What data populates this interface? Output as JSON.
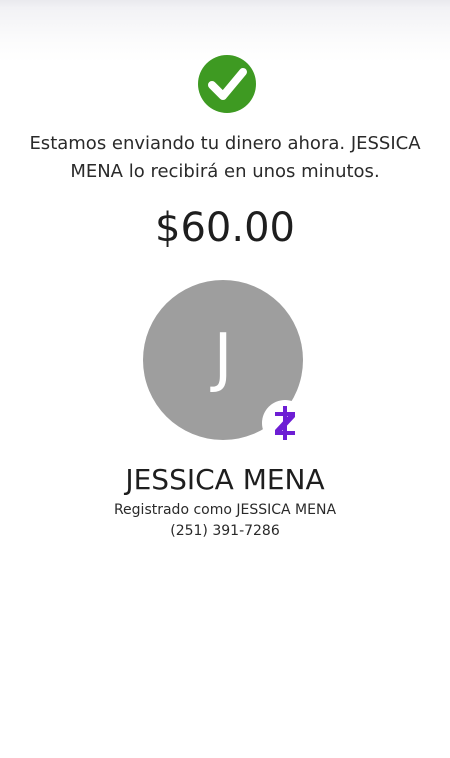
{
  "status": {
    "icon": "check-circle-icon",
    "color": "#3e9a22",
    "message": "Estamos enviando tu dinero ahora. JESSICA MENA lo recibirá en unos minutos."
  },
  "amount": "$60.00",
  "recipient": {
    "initial": "J",
    "avatar_color": "#9e9e9e",
    "name": "JESSICA MENA",
    "registered_as": "Registrado como JESSICA MENA",
    "phone": "(251) 391-7286",
    "badge_icon": "zelle-logo-icon",
    "badge_color": "#6d1ed4"
  }
}
